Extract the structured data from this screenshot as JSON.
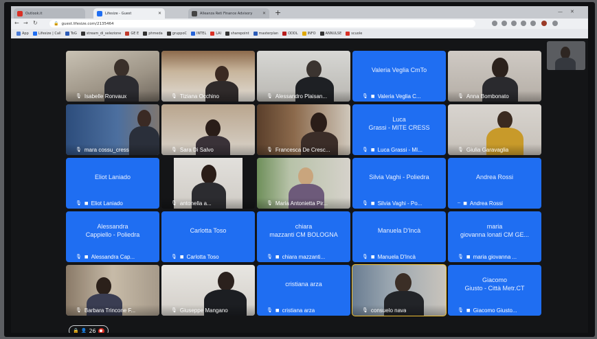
{
  "browser": {
    "tabs": [
      {
        "title": "Outlook.it",
        "fav_color": "#d93025"
      },
      {
        "title": "Lifesize - Guest",
        "fav_color": "#1f6ef2"
      },
      {
        "title": "Alleanza Reti Finance Advisory",
        "fav_color": "#444444"
      }
    ],
    "new_tab_symbol": "+",
    "url": "guest.lifesize.com/2135464",
    "bookmarks": [
      "App",
      "Lifesize | Call",
      "ToG",
      "stream_di_selezione",
      "GE E",
      "phmeda",
      "gruppoC",
      "INTEL",
      "LAI",
      "sharepoint",
      "masterplan",
      "ODDL",
      "INFO",
      "ANNULSE",
      "scuole"
    ]
  },
  "participants": [
    {
      "name": "Isabelle Ronvaux",
      "type": "video"
    },
    {
      "name": "Tiziana Occhino",
      "type": "video"
    },
    {
      "name": "Alessandro Plaisan...",
      "type": "video"
    },
    {
      "name": "Valeria Veglia C...",
      "display": "Valeria Veglia CmTo",
      "type": "name"
    },
    {
      "name": "Anna Bombonato",
      "type": "video"
    },
    {
      "name": "mara cossu_cress",
      "type": "video"
    },
    {
      "name": "Sara Di Salvo",
      "type": "video"
    },
    {
      "name": "Francesca De Cresc...",
      "type": "video"
    },
    {
      "name": "Luca Grassi - MI...",
      "display": "Luca\nGrassi - MITE CRESS",
      "type": "name"
    },
    {
      "name": "Giulia Garavaglia",
      "type": "video"
    },
    {
      "name": "Eliot Laniado",
      "display": "Eliot Laniado",
      "type": "name"
    },
    {
      "name": "antonella a...",
      "type": "video"
    },
    {
      "name": "Maria Antonietta Pir...",
      "type": "video"
    },
    {
      "name": "Silvia Vaghi - Po...",
      "display": "Silvia Vaghi - Poliedra",
      "type": "name"
    },
    {
      "name": "Andrea Rossi",
      "display": "Andrea Rossi",
      "type": "name"
    },
    {
      "name": "Alessandra Cap...",
      "display": "Alessandra\nCappiello - Poliedra",
      "type": "name"
    },
    {
      "name": "Carlotta Toso",
      "display": "Carlotta Toso",
      "type": "name"
    },
    {
      "name": "chiara mazzanti...",
      "display": "chiara\nmazzanti CM BOLOGNA",
      "type": "name"
    },
    {
      "name": "Manuela D'Incà",
      "display": "Manuela D'Incà",
      "type": "name"
    },
    {
      "name": "maria giovanna ...",
      "display": "maria\ngiovanna lonati CM GE...",
      "type": "name"
    },
    {
      "name": "Barbara Trincone F...",
      "type": "video"
    },
    {
      "name": "Giuseppe Mangano",
      "type": "video"
    },
    {
      "name": "cristiana arza",
      "display": "cristiana arza",
      "type": "name"
    },
    {
      "name": "consuelo nava",
      "type": "video"
    },
    {
      "name": "Giacomo Giusto...",
      "display": "Giacomo\nGiusto - Città Metr.CT",
      "type": "name"
    }
  ],
  "participant_count": "26",
  "colors": {
    "tile_blue": "#1f6ef2",
    "active_speaker": "#f1c233",
    "record": "#d93025"
  }
}
